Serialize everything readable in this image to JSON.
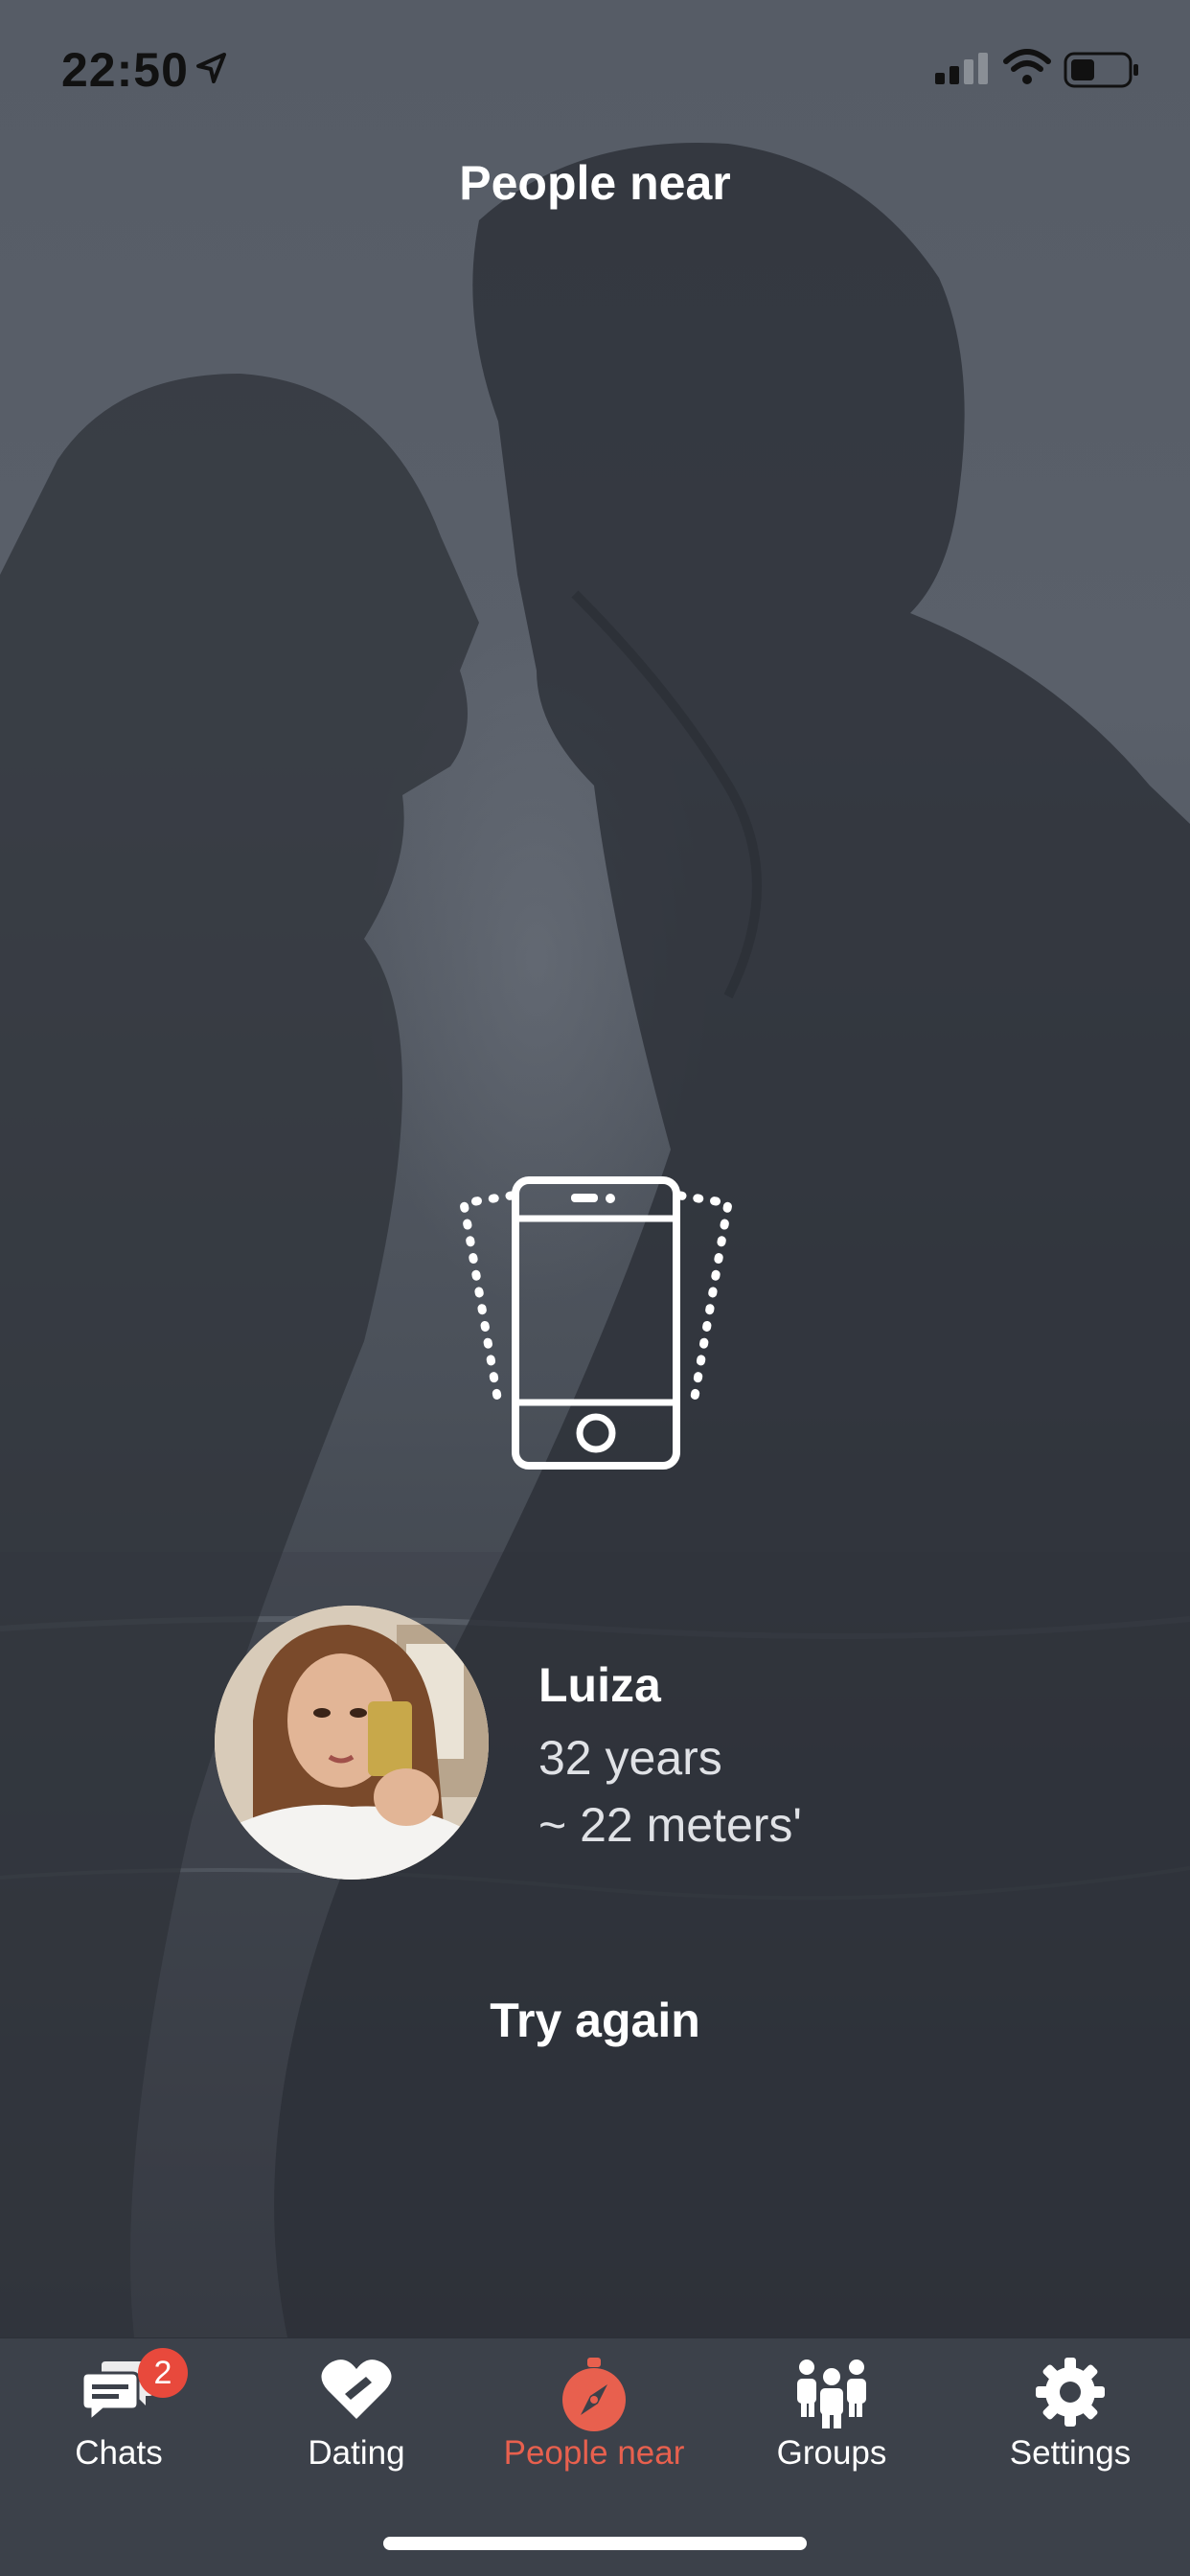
{
  "status_bar": {
    "time": "22:50"
  },
  "header": {
    "title": "People near"
  },
  "match": {
    "name": "Luiza",
    "age": "32 years",
    "distance": "~ 22 meters'"
  },
  "actions": {
    "try_again": "Try again"
  },
  "tabs": [
    {
      "label": "Chats",
      "badge": "2"
    },
    {
      "label": "Dating"
    },
    {
      "label": "People near",
      "active": true
    },
    {
      "label": "Groups"
    },
    {
      "label": "Settings"
    }
  ],
  "colors": {
    "accent": "#e8604e",
    "badge": "#e8493c",
    "tabbar": "#3c414a"
  }
}
